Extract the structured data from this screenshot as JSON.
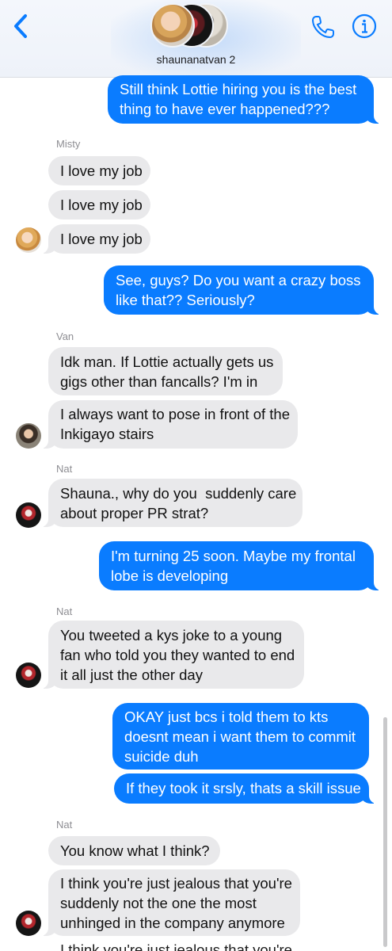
{
  "header": {
    "group_name": "shaunanatvan 2",
    "back_icon": "chevron-left-icon",
    "call_icon": "phone-icon",
    "info_icon": "info-icon",
    "accent": "#0a7cff"
  },
  "messages": [
    {
      "from": "me",
      "lines": [
        "Still think Lottie hiring you is the best",
        "thing to have ever happened???"
      ]
    },
    {
      "sender_label": "Misty"
    },
    {
      "from": "Misty",
      "lines": [
        "I love my job"
      ]
    },
    {
      "from": "Misty",
      "lines": [
        "I love my job"
      ]
    },
    {
      "from": "Misty",
      "lines": [
        "I love my job"
      ]
    },
    {
      "from": "me",
      "lines": [
        "See, guys? Do you want a crazy boss",
        "like that?? Seriously?"
      ]
    },
    {
      "sender_label": "Van"
    },
    {
      "from": "Van",
      "lines": [
        "Idk man. If Lottie actually gets us",
        "gigs other than fancalls? I'm in"
      ]
    },
    {
      "from": "Van",
      "lines": [
        "I always want to pose in front of the",
        "Inkigayo stairs"
      ]
    },
    {
      "sender_label": "Nat"
    },
    {
      "from": "Nat",
      "lines": [
        "Shauna., why do you  suddenly care",
        "about proper PR strat?"
      ]
    },
    {
      "from": "me",
      "lines": [
        "I'm turning 25 soon. Maybe my frontal",
        "lobe is developing"
      ]
    },
    {
      "sender_label": "Nat"
    },
    {
      "from": "Nat",
      "lines": [
        "You tweeted a kys joke to a young",
        "fan who told you they wanted to end",
        "it all just the other day"
      ]
    },
    {
      "from": "me",
      "lines": [
        "OKAY just bcs i told them to kts",
        "doesnt mean i want them to commit",
        "suicide duh"
      ]
    },
    {
      "from": "me",
      "lines": [
        "If they took it srsly, thats a skill issue"
      ]
    },
    {
      "sender_label": "Nat"
    },
    {
      "from": "Nat",
      "lines": [
        "You know what I think?"
      ]
    },
    {
      "from": "Nat",
      "lines": [
        "I think you're just jealous that you're",
        "suddenly not the one the most",
        "unhinged in the company anymore"
      ]
    },
    {
      "from": "Nat",
      "lines": [
        "I think you're just jealous that you're"
      ]
    }
  ],
  "colors": {
    "outgoing_bubble": "#0a7cff",
    "incoming_bubble": "#e9e9eb",
    "sender_label": "#8e8e93"
  }
}
